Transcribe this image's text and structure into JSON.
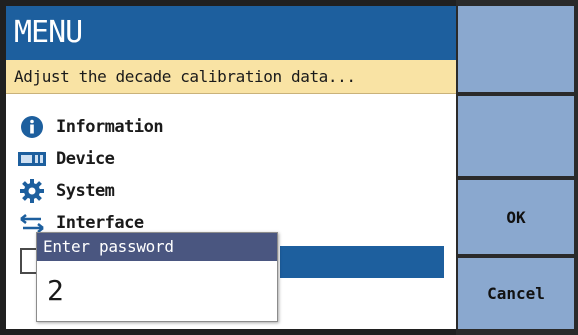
{
  "screen": {
    "title": "MENU",
    "hint": "Adjust the decade calibration data..."
  },
  "menu": {
    "items": [
      {
        "label": "Information",
        "icon": "info-icon"
      },
      {
        "label": "Device",
        "icon": "device-icon"
      },
      {
        "label": "System",
        "icon": "gear-icon"
      },
      {
        "label": "Interface",
        "icon": "interface-arrows-icon"
      }
    ]
  },
  "softkeys": {
    "ok_label": "OK",
    "cancel_label": "Cancel"
  },
  "password_dialog": {
    "title": "Enter password",
    "value": "2"
  },
  "colors": {
    "title_bg": "#1d5f9e",
    "hint_bg": "#f9e3a4",
    "softkey_bg": "#8aa8cf",
    "dialog_title_bg": "#4a5680"
  }
}
